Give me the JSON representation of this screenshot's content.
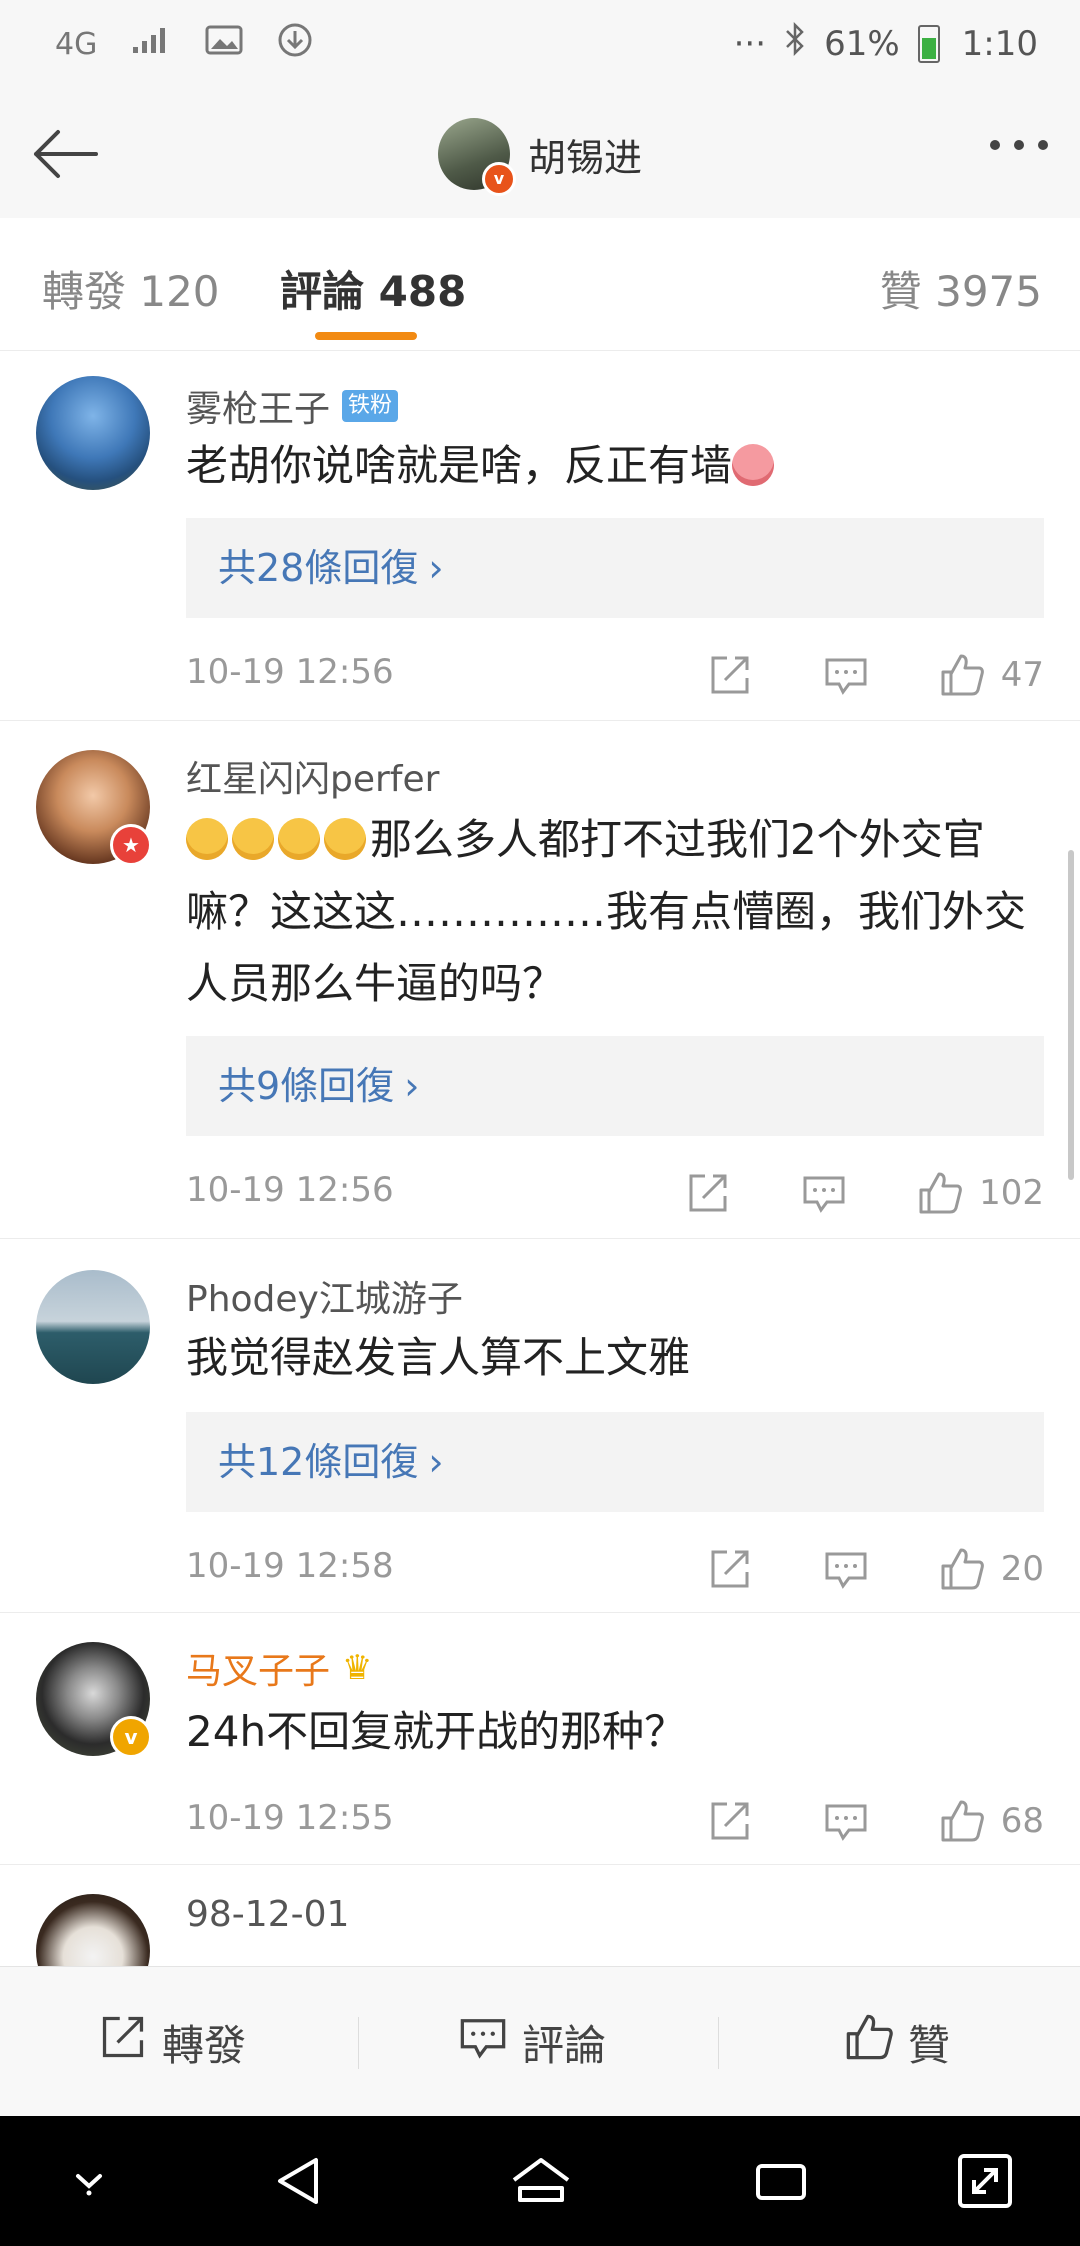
{
  "status_bar": {
    "network": "4G",
    "battery": "61%",
    "time": "1:10",
    "icons": [
      "4g-icon",
      "signal-icon",
      "image-icon",
      "download-icon",
      "more-dots-icon",
      "bluetooth-icon",
      "battery-icon"
    ]
  },
  "header": {
    "title": "胡锡进",
    "verified_mark": "v"
  },
  "tabs": [
    {
      "label": "轉發 120"
    },
    {
      "label": "評論 488"
    },
    {
      "label": "贊 3975"
    }
  ],
  "comments": [
    {
      "user": "雾枪王子",
      "tag": "铁粉",
      "text": "老胡你说啥就是啥，反正有墙",
      "replies": "共28條回復",
      "time": "10-19 12:56",
      "likes": "47"
    },
    {
      "user": "红星闪闪perfer",
      "text": "那么多人都打不过我们2个外交官嘛？这这这……………我有点懵圈，我们外交人员那么牛逼的吗？",
      "replies": "共9條回復",
      "time": "10-19 12:56",
      "likes": "102"
    },
    {
      "user": "Phodey江城游子",
      "text": "我觉得赵发言人算不上文雅",
      "replies": "共12條回復",
      "time": "10-19 12:58",
      "likes": "20"
    },
    {
      "user": "马叉子子",
      "text": "24h不回复就开战的那种？",
      "time": "10-19 12:55",
      "likes": "68"
    },
    {
      "user": "98-12-01"
    }
  ],
  "bottom_bar": {
    "repost": "轉發",
    "comment": "評論",
    "like": "贊"
  },
  "colors": {
    "accent": "#f28a12",
    "link": "#4677b6",
    "gold_name": "#e8781a"
  }
}
